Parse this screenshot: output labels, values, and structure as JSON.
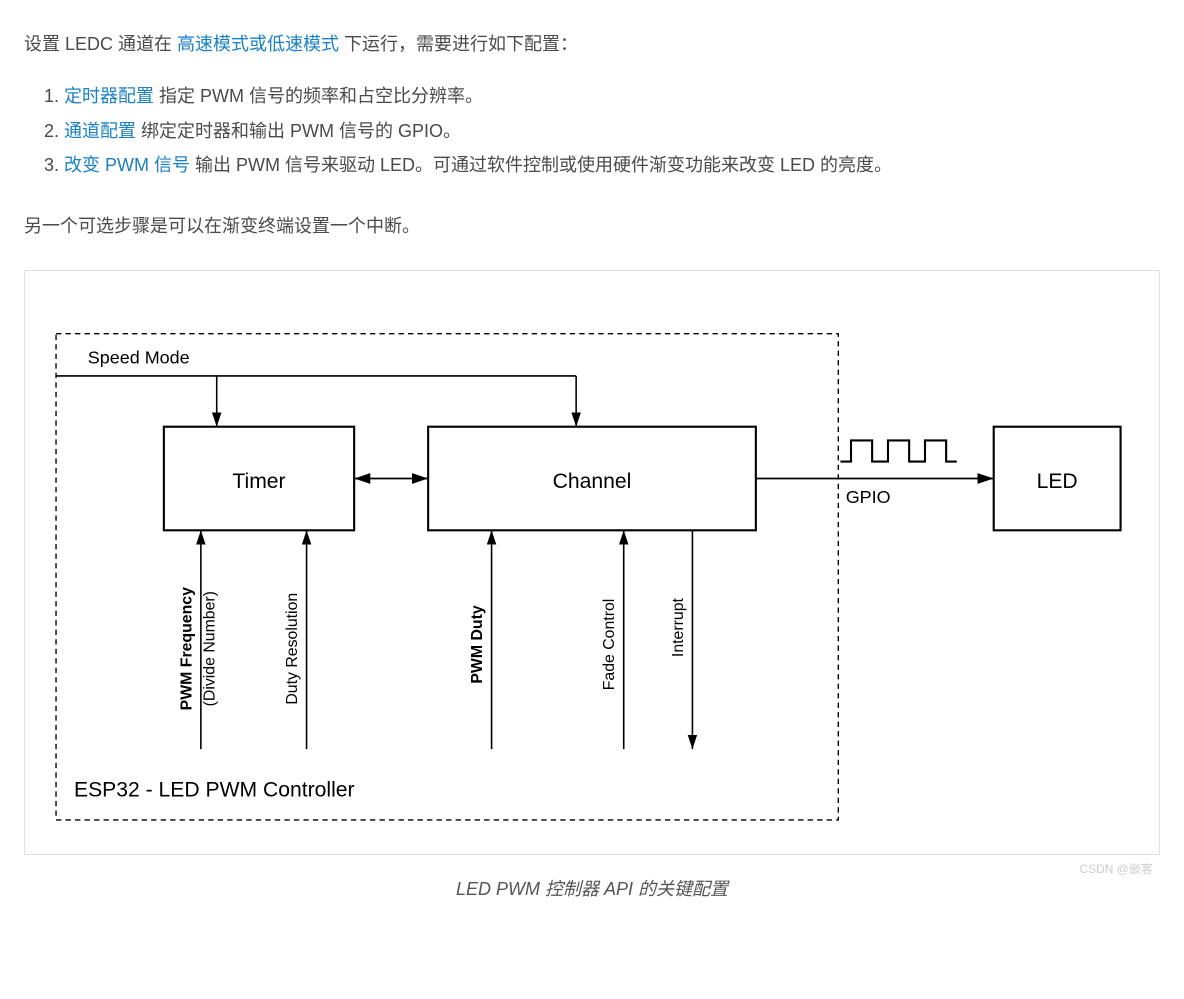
{
  "intro": {
    "prefix": "设置 LEDC 通道在 ",
    "link": "高速模式或低速模式",
    "suffix": " 下运行，需要进行如下配置："
  },
  "steps": [
    {
      "link": "定时器配置",
      "text": " 指定 PWM 信号的频率和占空比分辨率。"
    },
    {
      "link": "通道配置",
      "text": " 绑定定时器和输出 PWM 信号的 GPIO。"
    },
    {
      "link": "改变 PWM 信号",
      "text": " 输出 PWM 信号来驱动 LED。可通过软件控制或使用硬件渐变功能来改变 LED 的亮度。"
    }
  ],
  "note": "另一个可选步骤是可以在渐变终端设置一个中断。",
  "diagram": {
    "speed_mode": "Speed Mode",
    "timer": "Timer",
    "channel": "Channel",
    "led": "LED",
    "gpio": "GPIO",
    "title": "ESP32 - LED PWM Controller",
    "timer_inputs": {
      "freq": "PWM Frequency",
      "freq_sub": "(Divide Number)",
      "duty_res": "Duty Resolution"
    },
    "channel_inputs": {
      "pwm_duty": "PWM Duty",
      "fade": "Fade Control",
      "interrupt": "Interrupt"
    }
  },
  "caption": "LED PWM 控制器 API 的关键配置",
  "watermark": "CSDN @嵌客"
}
